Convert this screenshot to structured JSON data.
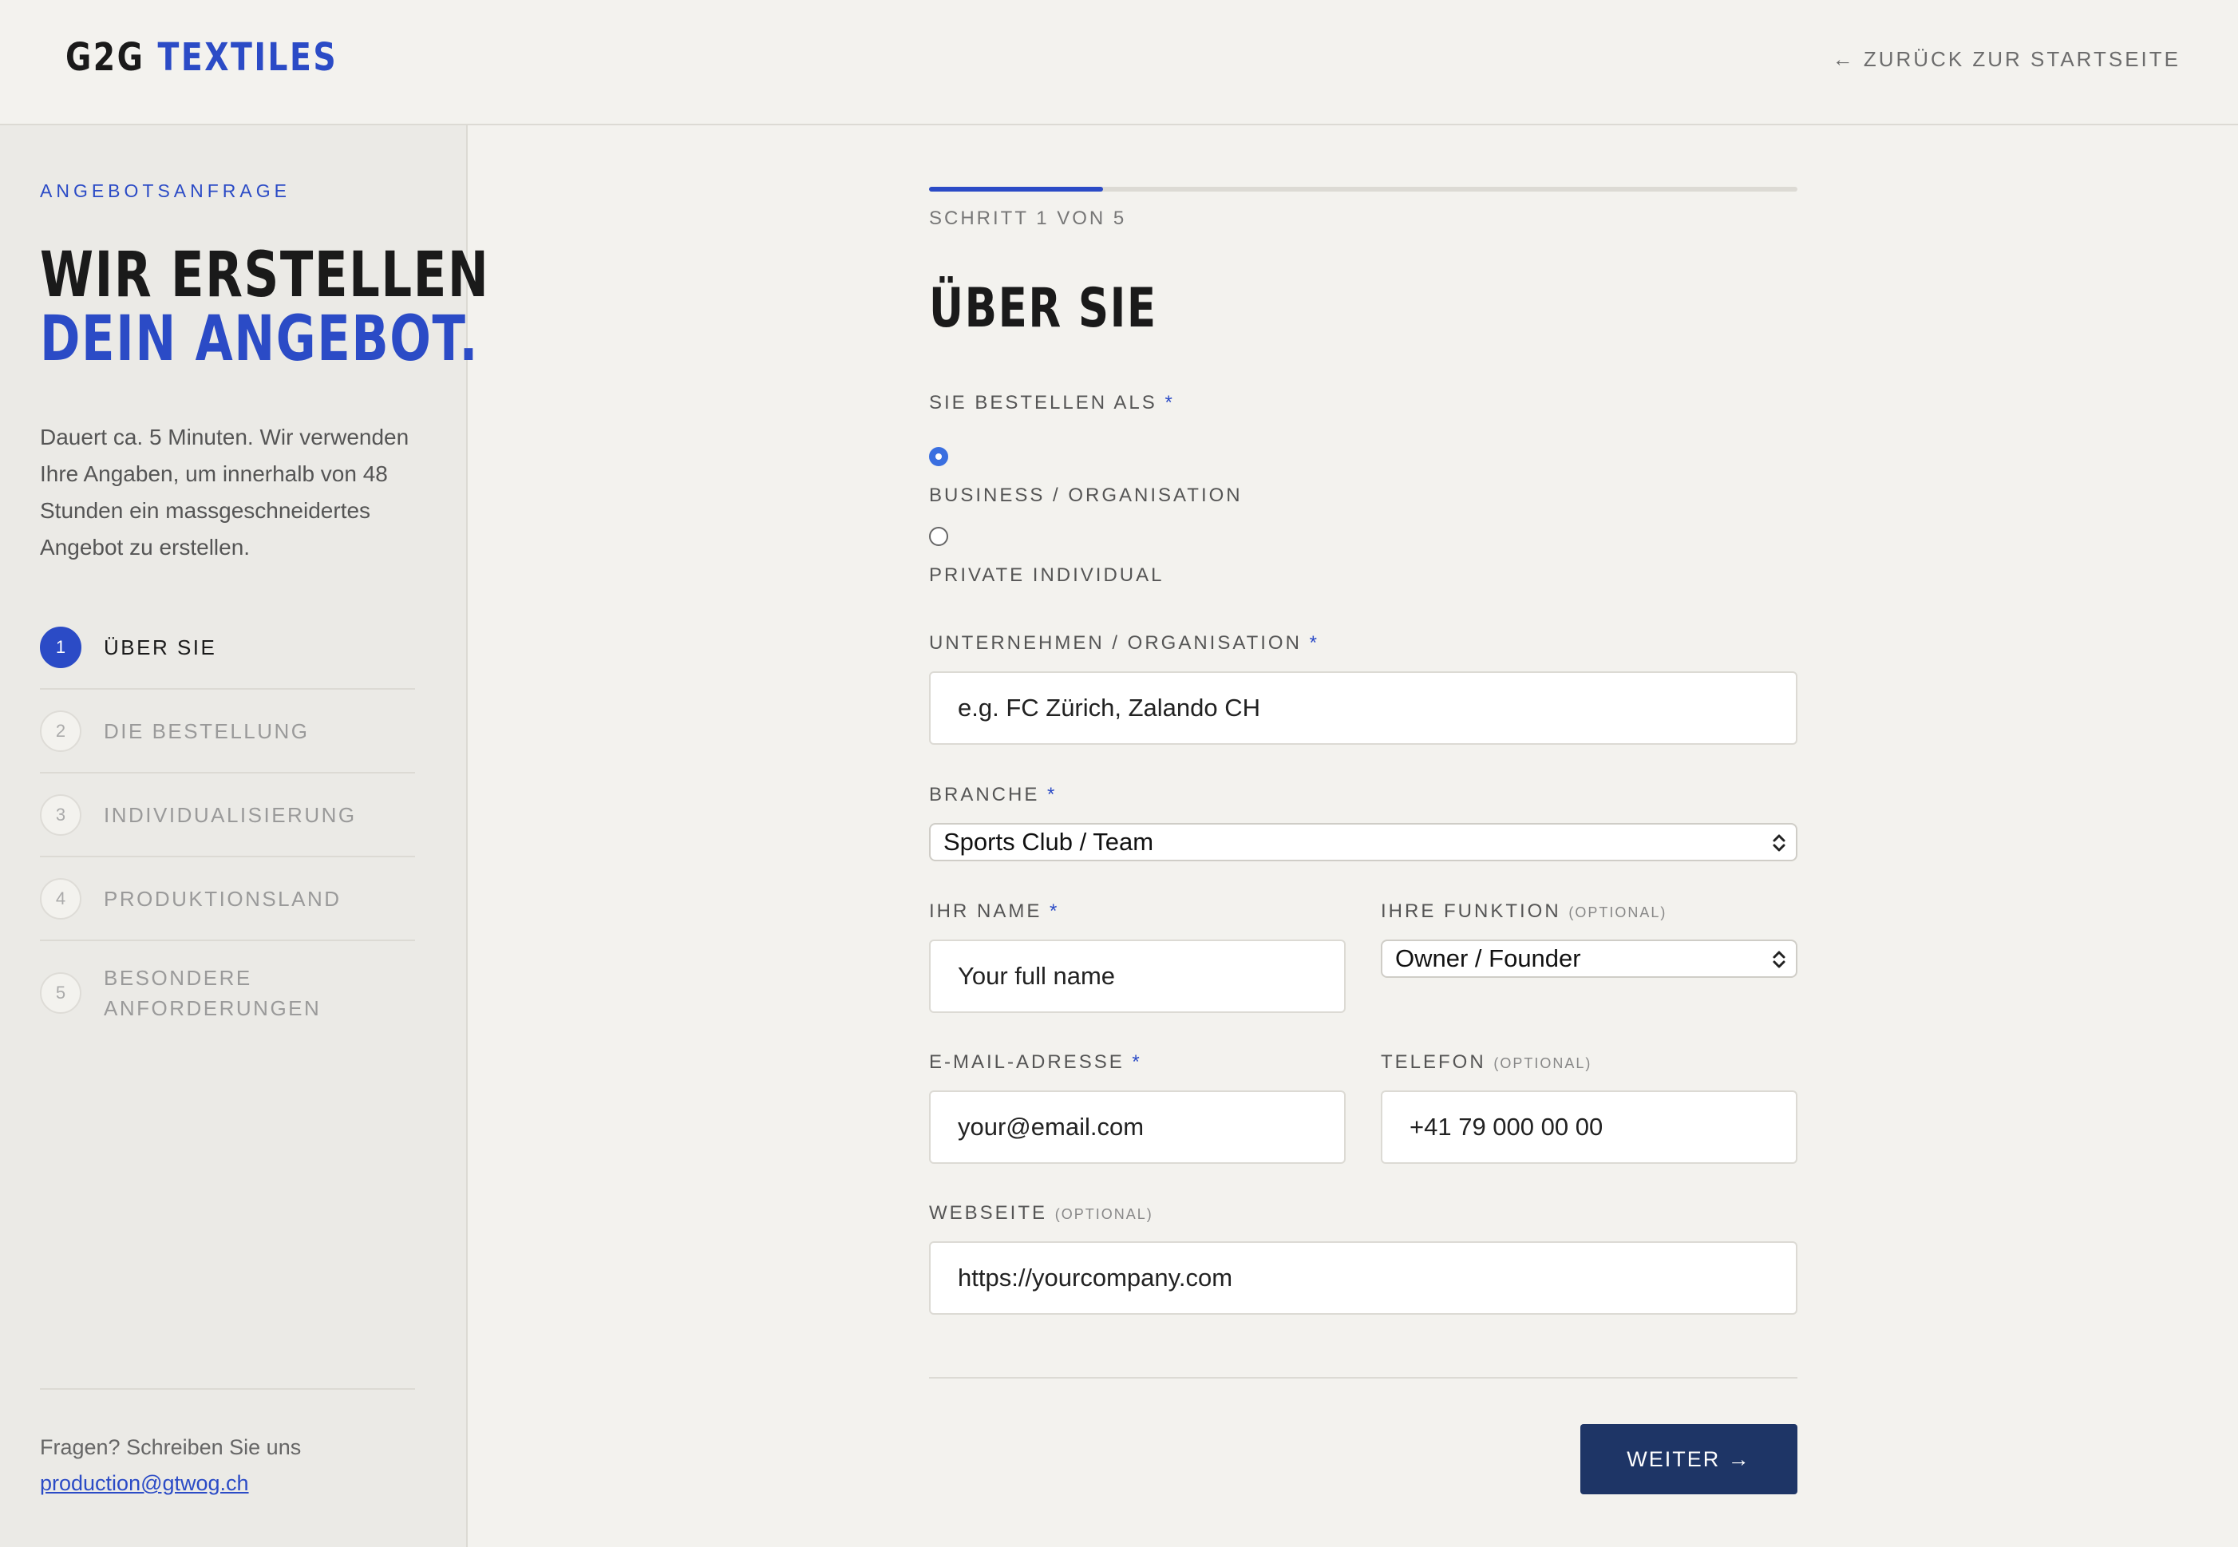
{
  "header": {
    "logo_part1": "G2G",
    "logo_part2": "TEXTILES",
    "back_link": "← ZURÜCK ZUR STARTSEITE"
  },
  "sidebar": {
    "eyebrow": "ANGEBOTSANFRAGE",
    "title_line1": "WIR ERSTELLEN",
    "title_line2": "DEIN ANGEBOT.",
    "description": "Dauert ca. 5 Minuten. Wir verwenden Ihre Angaben, um innerhalb von 48 Stunden ein massgeschneidertes Angebot zu erstellen.",
    "steps": [
      {
        "num": "1",
        "label": "ÜBER SIE"
      },
      {
        "num": "2",
        "label": "DIE BESTELLUNG"
      },
      {
        "num": "3",
        "label": "INDIVIDUALISIERUNG"
      },
      {
        "num": "4",
        "label": "PRODUKTIONSLAND"
      },
      {
        "num": "5",
        "label": "BESONDERE ANFORDERUNGEN"
      }
    ],
    "footer_text": "Fragen? Schreiben Sie uns",
    "footer_email": "production@gtwog.ch"
  },
  "main": {
    "progress_fraction": 0.2,
    "step_count": "SCHRITT 1 VON 5",
    "title": "ÜBER SIE",
    "order_as_label": "SIE BESTELLEN ALS",
    "radio_business": "BUSINESS / ORGANISATION",
    "radio_private": "PRIVATE INDIVIDUAL",
    "company_label": "UNTERNEHMEN / ORGANISATION",
    "company_placeholder": "e.g. FC Zürich, Zalando CH",
    "industry_label": "BRANCHE",
    "industry_value": "Sports Club / Team",
    "name_label": "IHR NAME",
    "name_placeholder": "Your full name",
    "function_label": "IHRE FUNKTION",
    "function_value": "Owner / Founder",
    "email_label": "E-MAIL-ADRESSE",
    "email_placeholder": "your@email.com",
    "phone_label": "TELEFON",
    "phone_placeholder": "+41 79 000 00 00",
    "website_label": "WEBSEITE",
    "website_placeholder": "https://yourcompany.com",
    "required_marker": "*",
    "optional_tag": "(OPTIONAL)",
    "next_button": "WEITER →"
  },
  "colors": {
    "accent": "#2b4bc6",
    "button": "#1e3566",
    "background": "#f3f2ee",
    "sidebar_bg": "#ebeae6"
  }
}
